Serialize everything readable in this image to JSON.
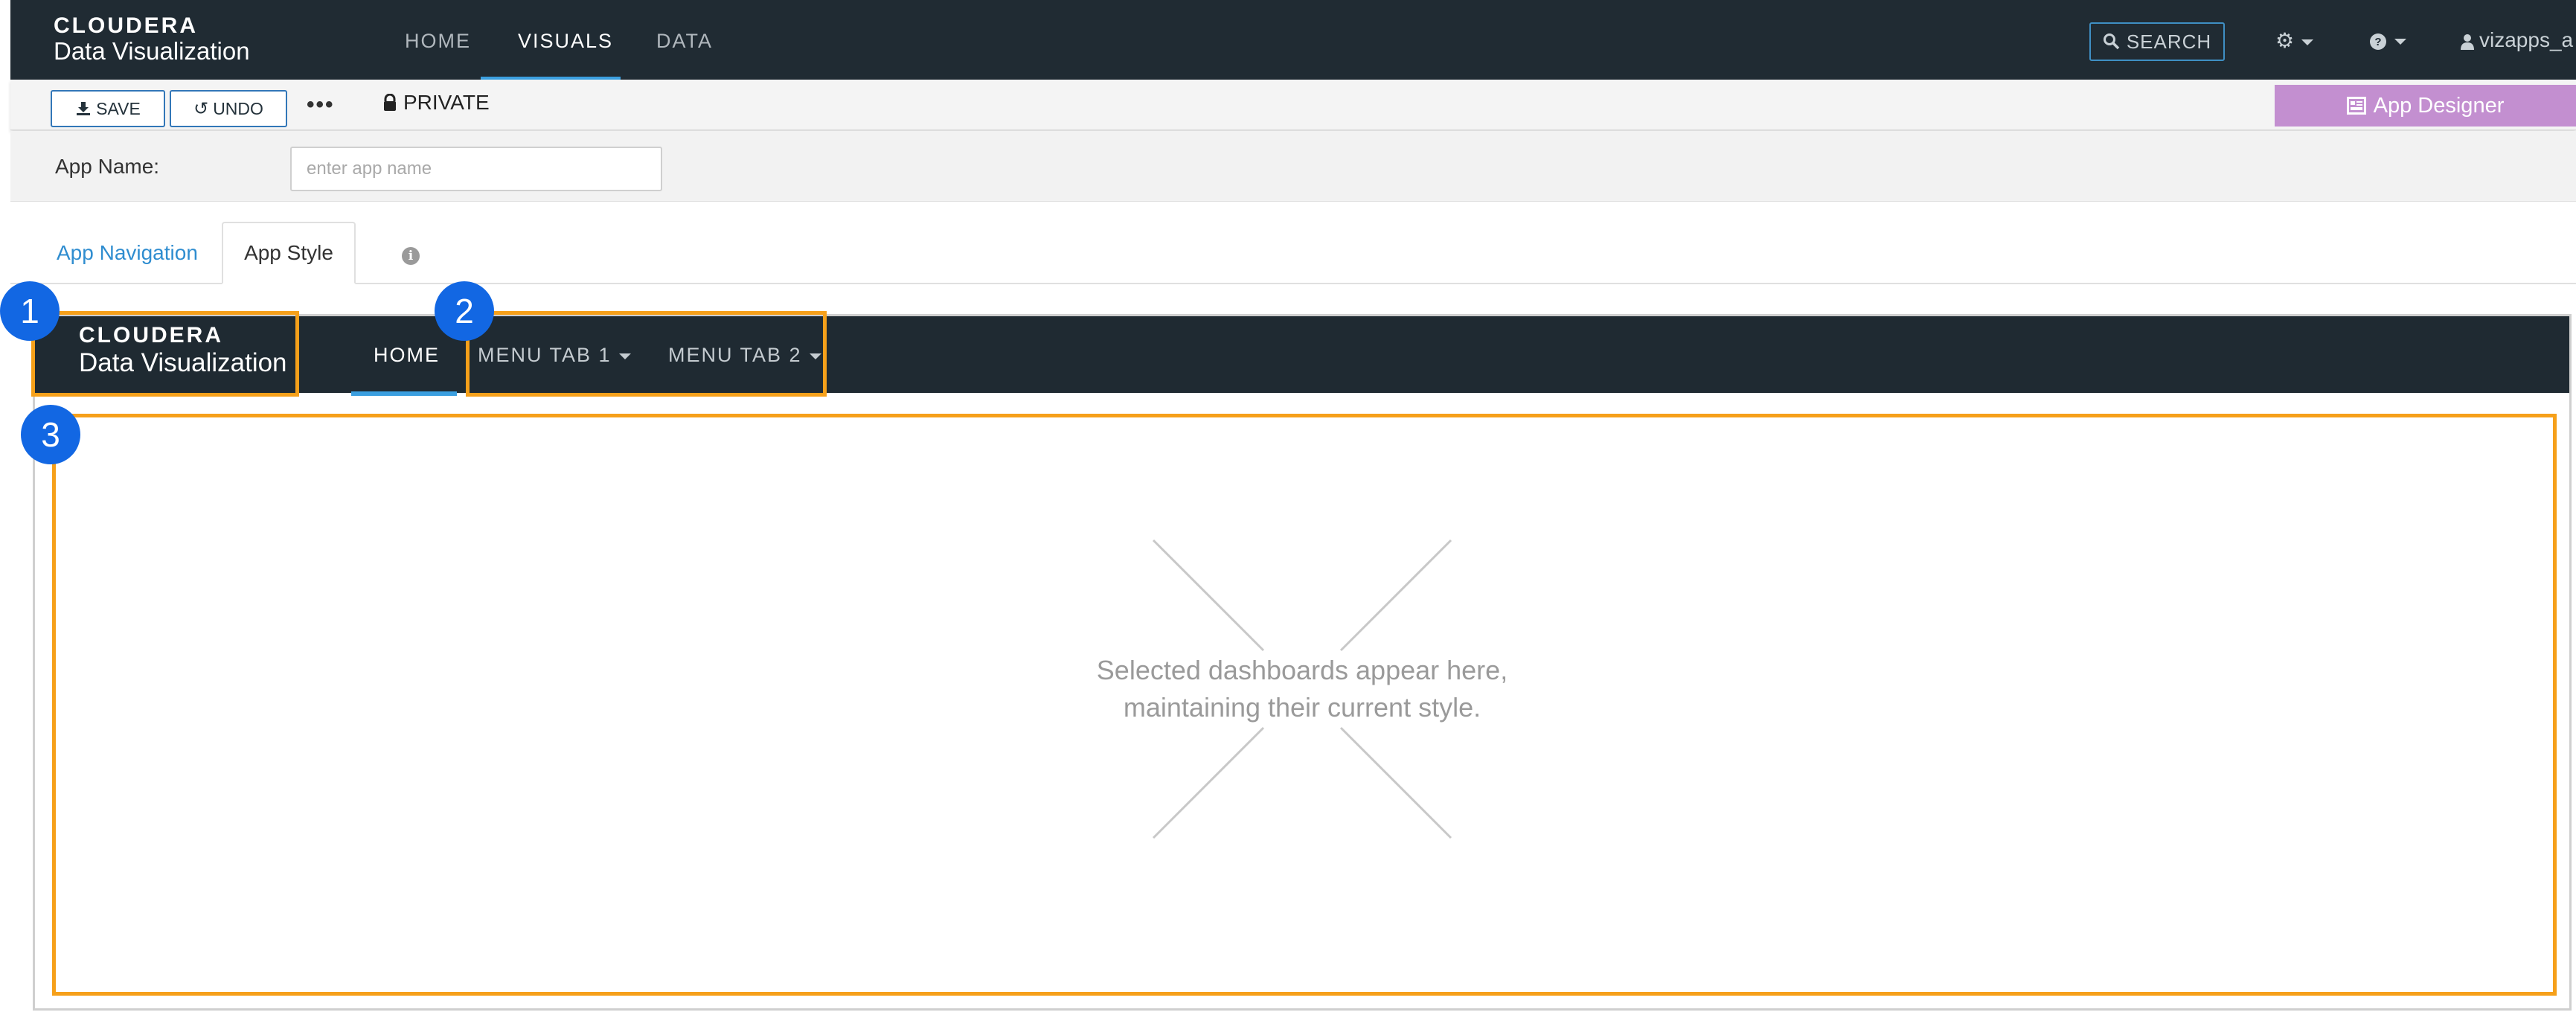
{
  "topnav": {
    "brand": "CLOUDERA",
    "product": "Data Visualization",
    "items": [
      "HOME",
      "VISUALS",
      "DATA"
    ],
    "active_item": "VISUALS",
    "search_label": "SEARCH",
    "user_label": "vizapps_a"
  },
  "toolbar": {
    "save_label": "SAVE",
    "undo_label": "UNDO",
    "more_label": "•••",
    "private_label": "PRIVATE",
    "app_designer_label": "App Designer"
  },
  "app_name": {
    "label": "App Name:",
    "placeholder": "enter app name",
    "value": ""
  },
  "tabs": {
    "items": [
      "App Navigation",
      "App Style"
    ],
    "active": "App Style",
    "info_glyph": "i"
  },
  "preview": {
    "brand": "CLOUDERA",
    "product": "Data Visualization",
    "nav_items": [
      "HOME",
      "MENU TAB 1",
      "MENU TAB 2"
    ],
    "active_item": "HOME",
    "placeholder_line1": "Selected dashboards appear here,",
    "placeholder_line2": "maintaining their current style."
  },
  "callouts": [
    "1",
    "2",
    "3"
  ],
  "colors": {
    "nav_bg": "#202b33",
    "accent_blue": "#3b9fe0",
    "app_designer": "#c38fd0",
    "highlight": "#f6a01a",
    "badge": "#1267e3"
  },
  "icons": [
    "download-icon",
    "undo-icon",
    "lock-icon",
    "search-icon",
    "gear-icon",
    "help-icon",
    "user-icon",
    "app-designer-icon",
    "info-icon",
    "caret-down-icon"
  ]
}
